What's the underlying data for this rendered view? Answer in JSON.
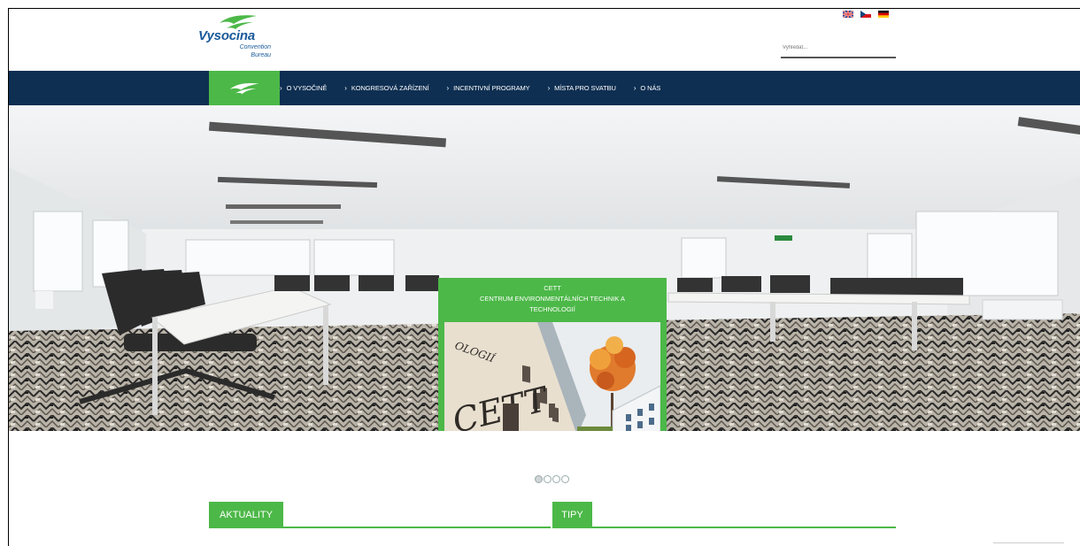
{
  "brand": {
    "name": "Vysocina",
    "subtitle_line1": "Convention",
    "subtitle_line2": "Bureau",
    "accent_color": "#4cb848",
    "navy_color": "#0e2f52",
    "logo_blue": "#1a5a9a"
  },
  "languages": [
    {
      "name": "english-flag-icon"
    },
    {
      "name": "czech-flag-icon"
    },
    {
      "name": "german-flag-icon"
    }
  ],
  "search": {
    "placeholder": "Vyhledat..."
  },
  "nav": {
    "items": [
      {
        "label": "O VYSOČINĚ"
      },
      {
        "label": "KONGRESOVÁ ZAŘÍZENÍ"
      },
      {
        "label": "INCENTIVNÍ PROGRAMY"
      },
      {
        "label": "MÍSTA PRO SVATBU"
      },
      {
        "label": "O NÁS"
      }
    ]
  },
  "hero": {
    "card_line1": "CETT",
    "card_line2": "CENTRUM ENVIRONMENTÁLNÍCH TECHNIK A",
    "card_line3": "TECHNOLOGIÍ",
    "photo_sign": "CETT",
    "photo_sign2": "OLOGIÍ"
  },
  "slider": {
    "slide_count": 4,
    "active_index": 0
  },
  "sections": {
    "news_label": "AKTUALITY",
    "tips_label": "TIPY"
  }
}
